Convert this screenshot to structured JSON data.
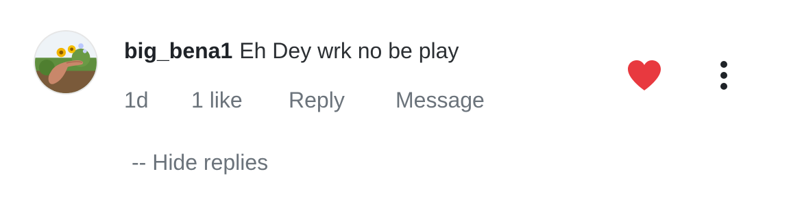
{
  "comment": {
    "avatar_icon": "user-avatar-photo",
    "username": "big_bena1",
    "text": "Eh Dey wrk no be play",
    "time": "1d",
    "likes": "1 like",
    "reply_label": "Reply",
    "message_label": "Message",
    "hide_replies_label": "-- Hide replies",
    "liked": true,
    "like_icon": "heart-filled-icon",
    "more_icon": "more-vertical-icon"
  },
  "colors": {
    "heart": "#e8393f",
    "text_primary": "#1f2328",
    "text_secondary": "#6b737b",
    "background": "#ffffff"
  }
}
